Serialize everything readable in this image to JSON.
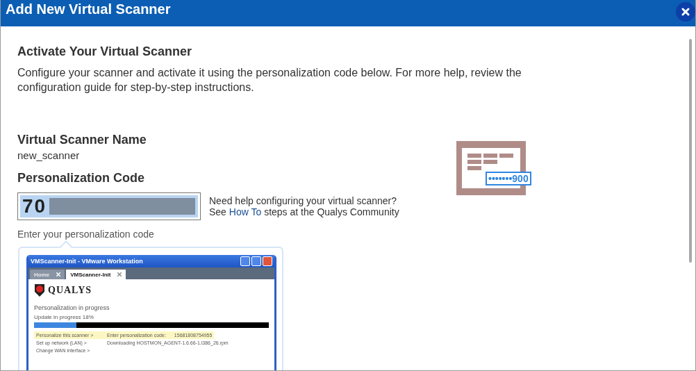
{
  "window": {
    "title": "Add New Virtual Scanner"
  },
  "heading": "Activate Your Virtual Scanner",
  "intro": "Configure your scanner and activate it using the personalization code below. For more help, review the configuration guide for step-by-step instructions.",
  "scanner_name": {
    "label": "Virtual Scanner Name",
    "value": "new_scanner"
  },
  "personalization_code": {
    "label": "Personalization Code",
    "value": "70",
    "redacted": true,
    "hint": "Enter your personalization code"
  },
  "help": {
    "line_1": "Need help configuring your virtual scanner?",
    "prefix": "See",
    "link": "How To",
    "suffix": "steps at the Qualys Community"
  },
  "illustration": {
    "code": "•••••••900"
  },
  "example_window": {
    "title": "VMScanner-Init - VMware Workstation",
    "tabs": [
      {
        "label": "Home",
        "selected": false
      },
      {
        "label": "VMScanner-Init",
        "selected": true
      }
    ],
    "logo": "QUALYS",
    "status": "Personalization in progress",
    "progress_label": "Update in progress 18%",
    "level": 0.18,
    "rows": [
      {
        "label": "Personalize this scanner >",
        "detail": "Enter personalization code:",
        "value": "15681808754955",
        "highlighted": true
      },
      {
        "label": "Set up network (LAN) >",
        "detail": "Downloading HOSTMON_AGENT-1.6.66-1.i386_26.rpm",
        "value": "",
        "highlighted": false
      },
      {
        "label": "Change WAN interface >",
        "highlighted": false
      }
    ]
  }
}
